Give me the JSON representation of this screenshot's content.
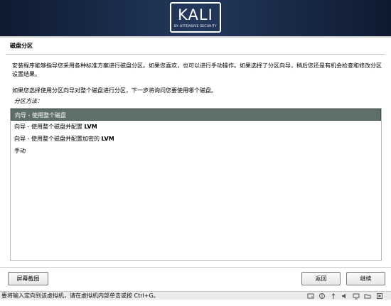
{
  "banner": {
    "logo_text": "KALI",
    "logo_subtext": "BY OFFENSIVE SECURITY"
  },
  "page": {
    "title": "磁盘分区",
    "description": "安装程序能够指导您采用各种标准方案进行磁盘分区。如果您喜欢，也可以进行手动操作。如果选择了分区向导，稍后您还是有机会检查和修改分区设置结果。",
    "question": "如果您选择使用分区向导对整个磁盘进行分区，下一步将询问您要使用哪个磁盘。",
    "list_label": "分区方法："
  },
  "options": [
    {
      "text": "向导 - 使用整个磁盘",
      "selected": true
    },
    {
      "text": "向导 - 使用整个磁盘并配置 LVM",
      "selected": false
    },
    {
      "text": "向导 - 使用整个磁盘并配置加密的 LVM",
      "selected": false
    },
    {
      "text": "手动",
      "selected": false
    }
  ],
  "buttons": {
    "screenshot": "屏幕截图",
    "back": "返回",
    "continue": "继续"
  },
  "statusbar": {
    "text": "要将输入定向到该虚拟机，请在虚拟机内部单击或按 Ctrl+G。",
    "icons": [
      "hard-disk-icon",
      "network-icon",
      "usb-icon",
      "sound-icon",
      "display-icon",
      "shared-folder-icon",
      "vm-icon"
    ]
  },
  "colors": {
    "banner": "#1c2c4a",
    "selected_row": "#5e7068"
  }
}
